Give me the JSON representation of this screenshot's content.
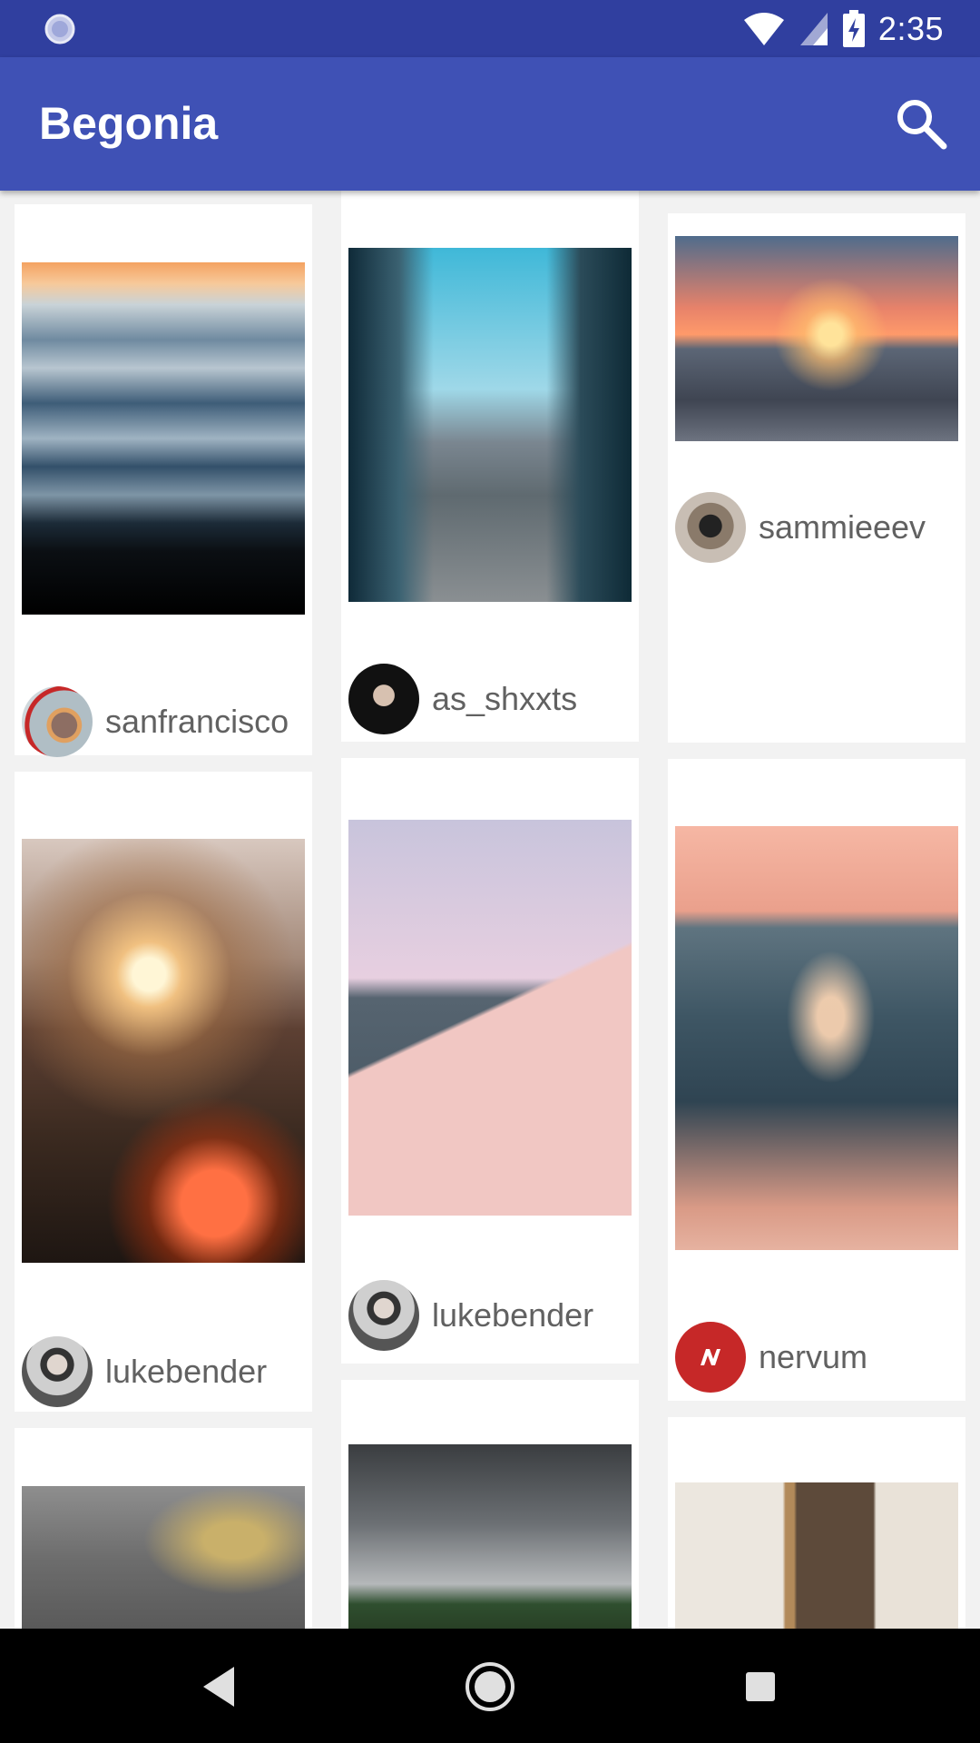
{
  "status_bar": {
    "time": "2:35"
  },
  "app_bar": {
    "title": "Begonia"
  },
  "feed": {
    "columns": [
      [
        {
          "username": "sanfrancisco"
        },
        {
          "username": "lukebender"
        },
        {
          "username": ""
        }
      ],
      [
        {
          "username": "as_shxxts"
        },
        {
          "username": "lukebender"
        },
        {
          "username": ""
        }
      ],
      [
        {
          "username": "sammieeev"
        },
        {
          "username": "nervum"
        },
        {
          "username": ""
        }
      ]
    ]
  },
  "colors": {
    "primary": "#3f51b5",
    "primary_dark": "#303f9f",
    "username_text": "#616161"
  },
  "icons": {
    "search": "search-icon",
    "back": "back-icon",
    "home": "home-icon",
    "recents": "recents-icon"
  }
}
